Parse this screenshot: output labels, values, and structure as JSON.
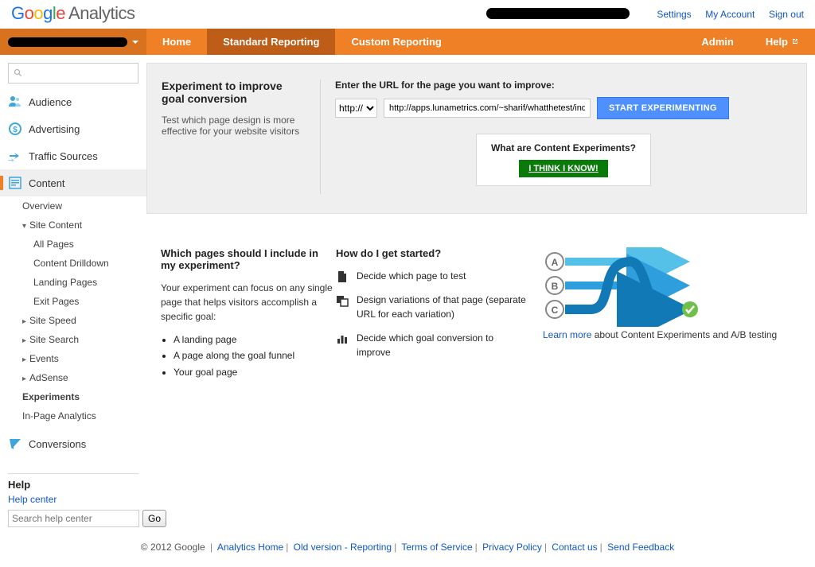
{
  "product": {
    "name": "Google",
    "sub": "Analytics"
  },
  "top_links": {
    "settings": "Settings",
    "my_account": "My Account",
    "sign_out": "Sign out"
  },
  "nav": {
    "home": "Home",
    "standard": "Standard Reporting",
    "custom": "Custom Reporting",
    "admin": "Admin",
    "help": "Help"
  },
  "sidebar": {
    "audience": "Audience",
    "advertising": "Advertising",
    "traffic": "Traffic Sources",
    "content": "Content",
    "content_items": {
      "overview": "Overview",
      "site_content": "Site Content",
      "all_pages": "All Pages",
      "drilldown": "Content Drilldown",
      "landing": "Landing Pages",
      "exit": "Exit Pages",
      "site_speed": "Site Speed",
      "site_search": "Site Search",
      "events": "Events",
      "adsense": "AdSense",
      "experiments": "Experiments",
      "inpage": "In-Page Analytics"
    },
    "conversions": "Conversions"
  },
  "help": {
    "title": "Help",
    "center": "Help center",
    "placeholder": "Search help center",
    "go": "Go"
  },
  "main": {
    "intro_title": "Experiment to improve goal conversion",
    "intro_body": "Test which page design is more effective for your website visitors",
    "form_label": "Enter the URL for the page you want to improve:",
    "protocol": "http://",
    "url_value": "http://apps.lunametrics.com/~sharif/whatthetest/index.html",
    "start_btn": "START EXPERIMENTING",
    "callout_title": "What are Content Experiments?",
    "callout_btn": "I THINK I KNOW!"
  },
  "cols": {
    "q1": "Which pages should I include in my experiment?",
    "q1_body": "Your experiment can focus on any single page that helps visitors accomplish a specific goal:",
    "q1_li": [
      "A landing page",
      "A page along the goal funnel",
      "Your goal page"
    ],
    "q2": "How do I get started?",
    "step1": "Decide which page to test",
    "step2": "Design variations of that page (separate URL for each variation)",
    "step3": "Decide which goal conversion to improve",
    "learn_more": "Learn more",
    "learn_more_tail": " about Content Experiments and A/B testing"
  },
  "footer": {
    "copyright": "© 2012 Google",
    "links": [
      "Analytics Home",
      "Old version - Reporting",
      "Terms of Service",
      "Privacy Policy",
      "Contact us",
      "Send Feedback"
    ]
  }
}
